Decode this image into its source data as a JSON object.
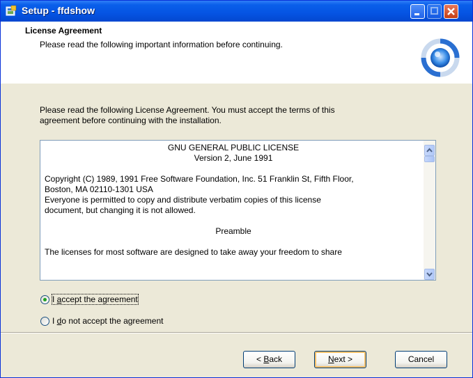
{
  "window": {
    "title": "Setup - ffdshow"
  },
  "header": {
    "title": "License Agreement",
    "subtitle": "Please read the following important information before continuing."
  },
  "intro": {
    "line1": "Please read the following License Agreement. You must accept the terms of this",
    "line2": "agreement before continuing with the installation."
  },
  "license": {
    "heading": "GNU GENERAL PUBLIC LICENSE",
    "version": "Version 2, June 1991",
    "copyright1": "Copyright (C) 1989, 1991 Free Software Foundation, Inc. 51 Franklin St, Fifth Floor,",
    "copyright2": "Boston, MA  02110-1301  USA",
    "perm1": "Everyone is permitted to copy and distribute verbatim copies of this license",
    "perm2": "document, but changing it is not allowed.",
    "preamble": "Preamble",
    "para1": "The licenses for most software are designed to take away your freedom to share"
  },
  "options": {
    "accept_pre": "I ",
    "accept_u": "a",
    "accept_post": "ccept the agreement",
    "decline_pre": "I ",
    "decline_u": "d",
    "decline_post": "o not accept the agreement",
    "selected": "accept"
  },
  "buttons": {
    "back_pre": "< ",
    "back_u": "B",
    "back_post": "ack",
    "next_u": "N",
    "next_post": "ext >",
    "cancel": "Cancel"
  },
  "icons": {
    "app": "setup-icon",
    "logo": "ffdshow-logo"
  }
}
